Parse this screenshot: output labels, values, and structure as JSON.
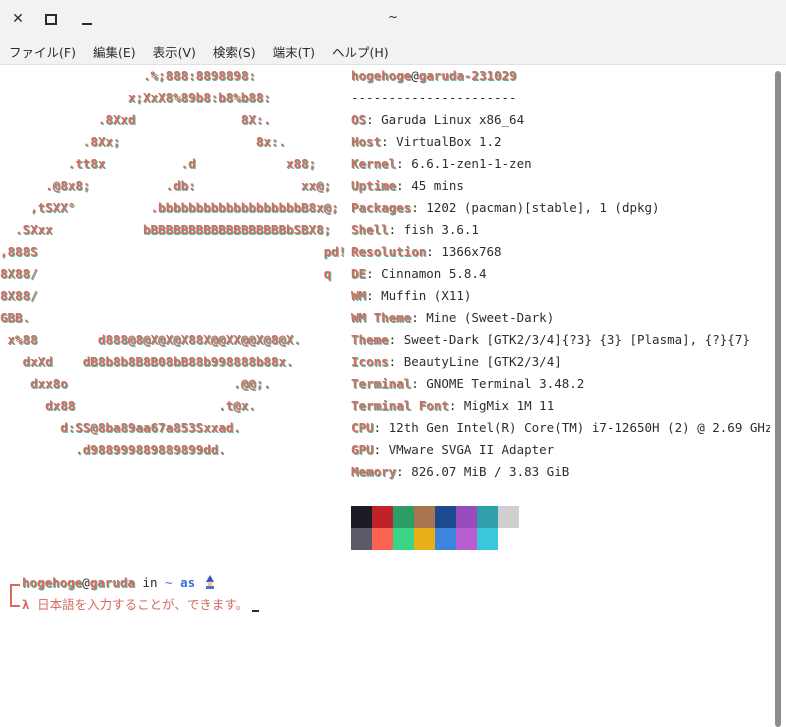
{
  "window": {
    "title": "~",
    "controls": {
      "close_icon": "close-icon",
      "maximize_icon": "maximize-icon",
      "minimize_icon": "minimize-icon"
    }
  },
  "menu": {
    "items": [
      {
        "label": "ファイル(F)"
      },
      {
        "label": "編集(E)"
      },
      {
        "label": "表示(V)"
      },
      {
        "label": "検索(S)"
      },
      {
        "label": "端末(T)"
      },
      {
        "label": "ヘルプ(H)"
      }
    ]
  },
  "logo": {
    "lines": [
      "                   .%;888:8898898:",
      "                 x;XxX8%89b8:b8%b88:",
      "             .8Xxd              8X:.",
      "           .8Xx;                  8x:.",
      "         .tt8x          .d            x88;",
      "      .@8x8;          .db:              xx@;",
      "    ,tSXX°          .bbbbbbbbbbbbbbbbbbbB8x@;",
      "  .SXxx            bBBBBBBBBBBBBBBBBBBbSBX8;",
      ",888S                                      pd!",
      "8X88/                                      q",
      "8X88/",
      "GBB.",
      " x%88        d888@8@X@X@X88X@@XX@@X@8@X.",
      "   dxXd    dB8b8b8B8B08bB88b998888b88x.",
      "    dxx8o                      .@@;.",
      "      dx88                   .t@x.",
      "        d:SS@8ba89aa67a853Sxxad.",
      "          .d988999889889899dd."
    ]
  },
  "info": {
    "user": "hogehoge",
    "host": "garuda-231029",
    "separator": "----------------------",
    "rows": [
      {
        "key": "OS",
        "value": "Garuda Linux x86_64"
      },
      {
        "key": "Host",
        "value": "VirtualBox 1.2"
      },
      {
        "key": "Kernel",
        "value": "6.6.1-zen1-1-zen"
      },
      {
        "key": "Uptime",
        "value": "45 mins"
      },
      {
        "key": "Packages",
        "value": "1202 (pacman)[stable], 1 (dpkg)"
      },
      {
        "key": "Shell",
        "value": "fish 3.6.1"
      },
      {
        "key": "Resolution",
        "value": "1366x768"
      },
      {
        "key": "DE",
        "value": "Cinnamon 5.8.4"
      },
      {
        "key": "WM",
        "value": "Muffin (X11)"
      },
      {
        "key": "WM Theme",
        "value": "Mine (Sweet-Dark)"
      },
      {
        "key": "Theme",
        "value": "Sweet-Dark [GTK2/3/4]{?3} {3} [Plasma], {?}{7}"
      },
      {
        "key": "Icons",
        "value": "BeautyLine [GTK2/3/4]"
      },
      {
        "key": "Terminal",
        "value": "GNOME Terminal 3.48.2"
      },
      {
        "key": "Terminal Font",
        "value": "MigMix 1M 11"
      },
      {
        "key": "CPU",
        "value": "12th Gen Intel(R) Core(TM) i7-12650H (2) @ 2.69 GHz"
      },
      {
        "key": "GPU",
        "value": "VMware SVGA II Adapter"
      },
      {
        "key": "Memory",
        "value": "826.07 MiB / 3.83 GiB"
      }
    ],
    "palette_top": [
      "#1b1b26",
      "#c0222c",
      "#2e9e68",
      "#a8754e",
      "#1b4b8f",
      "#9a4bbd",
      "#2f9fab",
      "#cfcfcf"
    ],
    "palette_bottom": [
      "#5b5b68",
      "#fa6350",
      "#39d486",
      "#e8b016",
      "#3c84dd",
      "#b85ed1",
      "#3cc6d9",
      "#ffffff"
    ]
  },
  "prompt": {
    "user": "hogehoge",
    "at": "@",
    "host": "garuda",
    "in": "in",
    "tilde": "~",
    "as": "as",
    "emoji_icon": "wizard-icon",
    "lambda": "λ",
    "input_text": "日本語を入力することが、できます。"
  }
}
